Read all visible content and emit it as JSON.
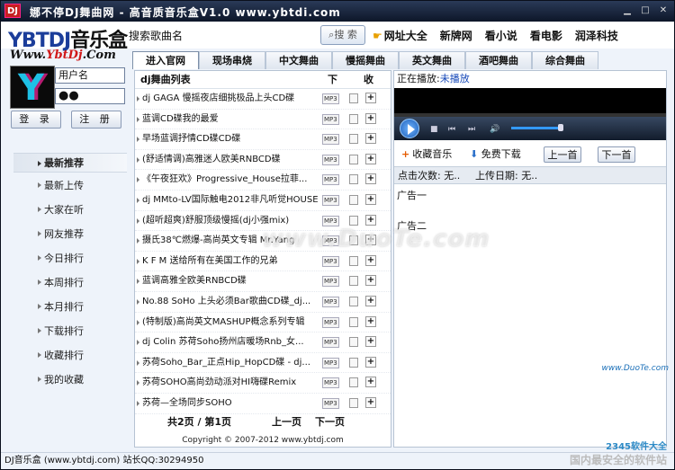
{
  "window": {
    "logo_text": "DJ",
    "title": "娜不停DJ舞曲网 - 高音质音乐盒V1.0  www.ybtdi.com"
  },
  "header": {
    "logo_en": "YBTDJ",
    "logo_cn": "音乐盒",
    "url_logo_a": "Www.",
    "url_logo_b": "YbtDj",
    "url_logo_c": ".Com",
    "search_placeholder": "搜索歌曲名",
    "search_button": "搜 索",
    "links": [
      "网址大全",
      "新牌网",
      "看小说",
      "看电影",
      "润泽科技"
    ]
  },
  "tabs": [
    "进入官网",
    "现场串烧",
    "中文舞曲",
    "慢摇舞曲",
    "英文舞曲",
    "酒吧舞曲",
    "综合舞曲"
  ],
  "login": {
    "username_placeholder": "用户名",
    "password_value": "●●",
    "login_label": "登 录",
    "register_label": "注 册"
  },
  "nav": [
    "最新推荐",
    "最新上传",
    "大家在听",
    "网友推荐",
    "今日排行",
    "本周排行",
    "本月排行",
    "下载排行",
    "收藏排行",
    "我的收藏"
  ],
  "list": {
    "header": "dj舞曲列表",
    "col_download": "下",
    "col_fav": "收",
    "badge": "MP3",
    "add": "+",
    "rows": [
      "dj GAGA 慢摇夜店细挑极品上头CD碟",
      "蓝调CD碟我的最爱",
      "早场蓝调抒情CD碟CD碟",
      "(舒适情调)高雅迷人欧美RNBCD碟",
      "《午夜狂欢》Progressive_House拉菲...",
      "dj MMto-LV国际触电2012非凡听觉HOUSE",
      "(超听超爽)舒服顶级慢摇(dj小强mix)",
      "摄氏38℃燃爆-高尚英文专辑 Mr.Yang",
      "K F M 送给所有在美国工作的兄弟",
      "蓝调高雅全欧美RNBCD碟",
      "No.88 SoHo 上头必须Bar歌曲CD碟_dj...",
      "(特制版)高尚英文MASHUP概念系列专辑",
      "dj Colin 苏荷Soho扬州店暖场Rnb_女...",
      "苏荷Soho_Bar_正点Hip_HopCD碟 - dj...",
      "苏荷SOHO高尚劲动派对HI嗨碟Remix",
      "苏荷—全场同步SOHO"
    ],
    "pager_pages": "共2页 / 第1页",
    "pager_prev": "上一页",
    "pager_next": "下一页",
    "copyright": "Copyright © 2007-2012 www.ybtdj.com"
  },
  "player": {
    "now_label": "正在播放:",
    "now_value": "未播放",
    "collect": "收藏音乐",
    "download": "免费下载",
    "prev": "上一首",
    "next": "下一首",
    "clicks_label": "点击次数: 无..",
    "upload_label": "上传日期: 无..",
    "ad1": "广告一",
    "ad2": "广告二"
  },
  "status": "DJ音乐盒 (www.ybtdj.com) 站长QQ:30294950",
  "watermark": {
    "main": "www.DuoTe.com",
    "site": "2345软件大全",
    "slogan": "国内最安全的软件站",
    "corner": "www.DuoTe.com"
  }
}
